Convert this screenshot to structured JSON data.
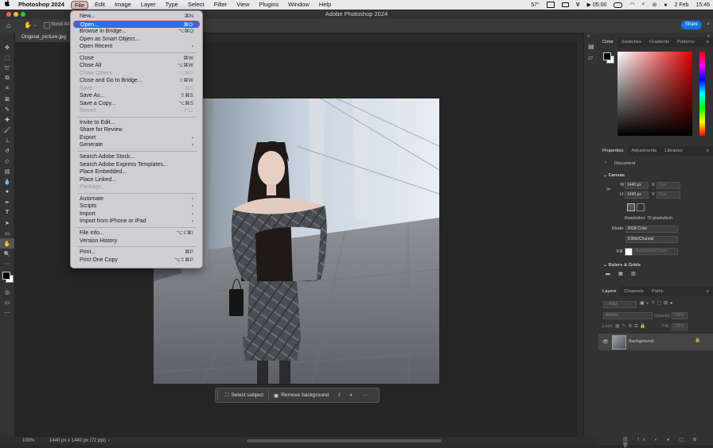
{
  "menubar": {
    "app_name": "Photoshop 2024",
    "menus": [
      "File",
      "Edit",
      "Image",
      "Layer",
      "Type",
      "Select",
      "Filter",
      "View",
      "Plugins",
      "Window",
      "Help"
    ],
    "status": {
      "temp": "57°",
      "time_badge": "05:00",
      "date": "2 Feb",
      "clock": "15:46"
    }
  },
  "window": {
    "title": "Adobe Photoshop 2024"
  },
  "options": {
    "scroll_all": "Scroll All",
    "share": "Share"
  },
  "document": {
    "tab_name": "Original_picture.jpg",
    "zoom": "100%",
    "info": "1440 px x 1440 px (72 ppi)"
  },
  "file_menu": {
    "items": [
      {
        "label": "New...",
        "shortcut": "⌘N",
        "disabled": false
      },
      {
        "label": "Open...",
        "shortcut": "⌘O",
        "disabled": false,
        "selected": true
      },
      {
        "label": "Browse in Bridge...",
        "shortcut": "⌥⌘O",
        "disabled": false
      },
      {
        "label": "Open as Smart Object...",
        "shortcut": "",
        "disabled": false
      },
      {
        "label": "Open Recent",
        "shortcut": "›",
        "disabled": false
      },
      {
        "label": "Close",
        "shortcut": "⌘W",
        "disabled": false
      },
      {
        "label": "Close All",
        "shortcut": "⌥⌘W",
        "disabled": false
      },
      {
        "label": "Close Others",
        "shortcut": "⌥⌘P",
        "disabled": true
      },
      {
        "label": "Close and Go to Bridge...",
        "shortcut": "⇧⌘W",
        "disabled": false
      },
      {
        "label": "Save",
        "shortcut": "⌘S",
        "disabled": true
      },
      {
        "label": "Save As...",
        "shortcut": "⇧⌘S",
        "disabled": false
      },
      {
        "label": "Save a Copy...",
        "shortcut": "⌥⌘S",
        "disabled": false
      },
      {
        "label": "Revert",
        "shortcut": "F12",
        "disabled": true
      },
      {
        "label": "Invite to Edit...",
        "shortcut": "",
        "disabled": false
      },
      {
        "label": "Share for Review",
        "shortcut": "",
        "disabled": false
      },
      {
        "label": "Export",
        "shortcut": "›",
        "disabled": false
      },
      {
        "label": "Generate",
        "shortcut": "›",
        "disabled": false
      },
      {
        "label": "Search Adobe Stock...",
        "shortcut": "",
        "disabled": false
      },
      {
        "label": "Search Adobe Express Templates...",
        "shortcut": "",
        "disabled": false
      },
      {
        "label": "Place Embedded...",
        "shortcut": "",
        "disabled": false
      },
      {
        "label": "Place Linked...",
        "shortcut": "",
        "disabled": false
      },
      {
        "label": "Package...",
        "shortcut": "",
        "disabled": true
      },
      {
        "label": "Automate",
        "shortcut": "›",
        "disabled": false
      },
      {
        "label": "Scripts",
        "shortcut": "›",
        "disabled": false
      },
      {
        "label": "Import",
        "shortcut": "›",
        "disabled": false
      },
      {
        "label": "Import from iPhone or iPad",
        "shortcut": "›",
        "disabled": false
      },
      {
        "label": "File Info...",
        "shortcut": "⌥⇧⌘I",
        "disabled": false
      },
      {
        "label": "Version History",
        "shortcut": "",
        "disabled": false
      },
      {
        "label": "Print...",
        "shortcut": "⌘P",
        "disabled": false
      },
      {
        "label": "Print One Copy",
        "shortcut": "⌥⇧⌘P",
        "disabled": false
      }
    ]
  },
  "context_bar": {
    "select_subject": "Select subject",
    "remove_background": "Remove background"
  },
  "color_panel": {
    "tabs": [
      "Color",
      "Swatches",
      "Gradients",
      "Patterns"
    ]
  },
  "properties": {
    "tabs": [
      "Properties",
      "Adjustments",
      "Libraries"
    ],
    "doc_label": "Document",
    "section_canvas": "Canvas",
    "w_label": "W",
    "w_value": "1440 px",
    "h_label": "H",
    "h_value": "1440 px",
    "x_label": "X",
    "x_value": "0 px",
    "y_label": "Y",
    "y_value": "0 px",
    "resolution": "Resolution: 72 pixels/inch",
    "mode_label": "Mode",
    "mode_value": "RGB Color",
    "bits_value": "8 Bits/Channel",
    "fill_label": "Fill",
    "fill_value": "Background Color",
    "section_rulers": "Rulers & Grids"
  },
  "layers": {
    "tabs": [
      "Layers",
      "Channels",
      "Paths"
    ],
    "kind_placeholder": "Kind",
    "blend": "Normal",
    "opacity_label": "Opacity:",
    "opacity": "100%",
    "lock_label": "Lock:",
    "fill_label": "Fill:",
    "fill": "100%",
    "layer_name": "Background"
  },
  "colors": {
    "accent": "#1473e6",
    "menu_highlight": "#2f6ee8",
    "annotation": "#e0332a"
  }
}
